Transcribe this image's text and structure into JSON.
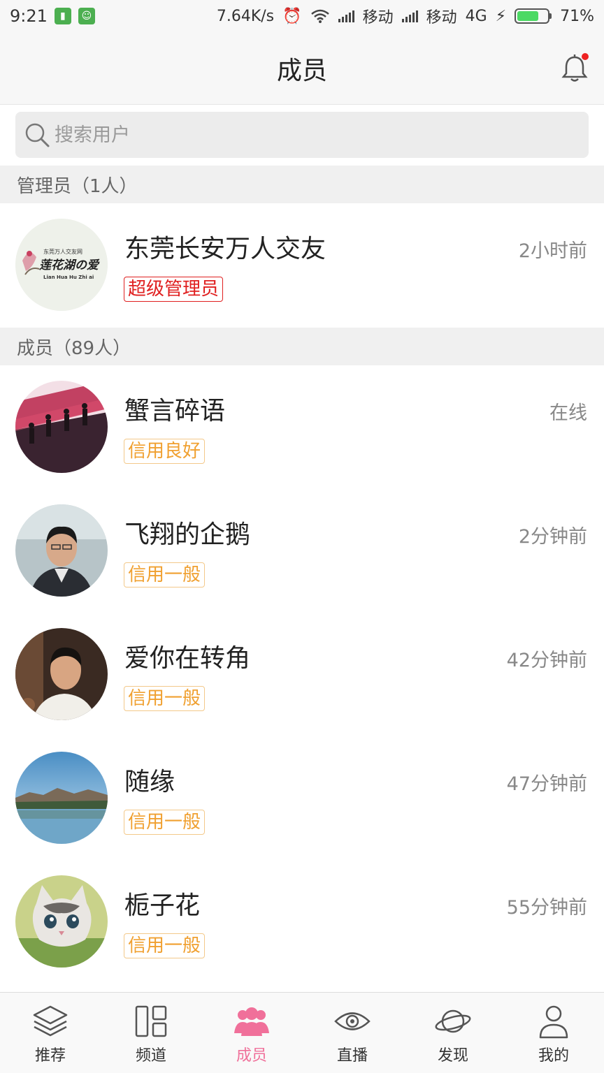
{
  "status_bar": {
    "time": "9:21",
    "network_speed": "7.64K/s",
    "carrier1": "移动",
    "carrier2": "移动",
    "network_type": "4G",
    "battery": "71%",
    "battery_level": 0.71
  },
  "header": {
    "title": "成员"
  },
  "search": {
    "placeholder": "搜索用户"
  },
  "sections": {
    "admins": "管理员（1人）",
    "members": "成员（89人）"
  },
  "admin": {
    "name": "东莞长安万人交友",
    "time": "2小时前",
    "badge": "超级管理员",
    "avatar_text": {
      "top": "东莞万人交友网",
      "main": "莲花湖の爱",
      "sub": "Lian Hua Hu Zhi ai"
    }
  },
  "members": [
    {
      "name": "蟹言碎语",
      "time": "在线",
      "badge": "信用良好"
    },
    {
      "name": "飞翔的企鹅",
      "time": "2分钟前",
      "badge": "信用一般"
    },
    {
      "name": "爱你在转角",
      "time": "42分钟前",
      "badge": "信用一般"
    },
    {
      "name": "随缘",
      "time": "47分钟前",
      "badge": "信用一般"
    },
    {
      "name": "栀子花",
      "time": "55分钟前",
      "badge": "信用一般"
    }
  ],
  "tabs": [
    {
      "label": "推荐",
      "icon": "layers-icon"
    },
    {
      "label": "频道",
      "icon": "grid-icon"
    },
    {
      "label": "成员",
      "icon": "users-icon"
    },
    {
      "label": "直播",
      "icon": "eye-icon"
    },
    {
      "label": "发现",
      "icon": "planet-icon"
    },
    {
      "label": "我的",
      "icon": "person-icon"
    }
  ],
  "colors": {
    "accent": "#f0709a",
    "admin_badge": "#e02020",
    "credit_badge": "#f0a030"
  }
}
